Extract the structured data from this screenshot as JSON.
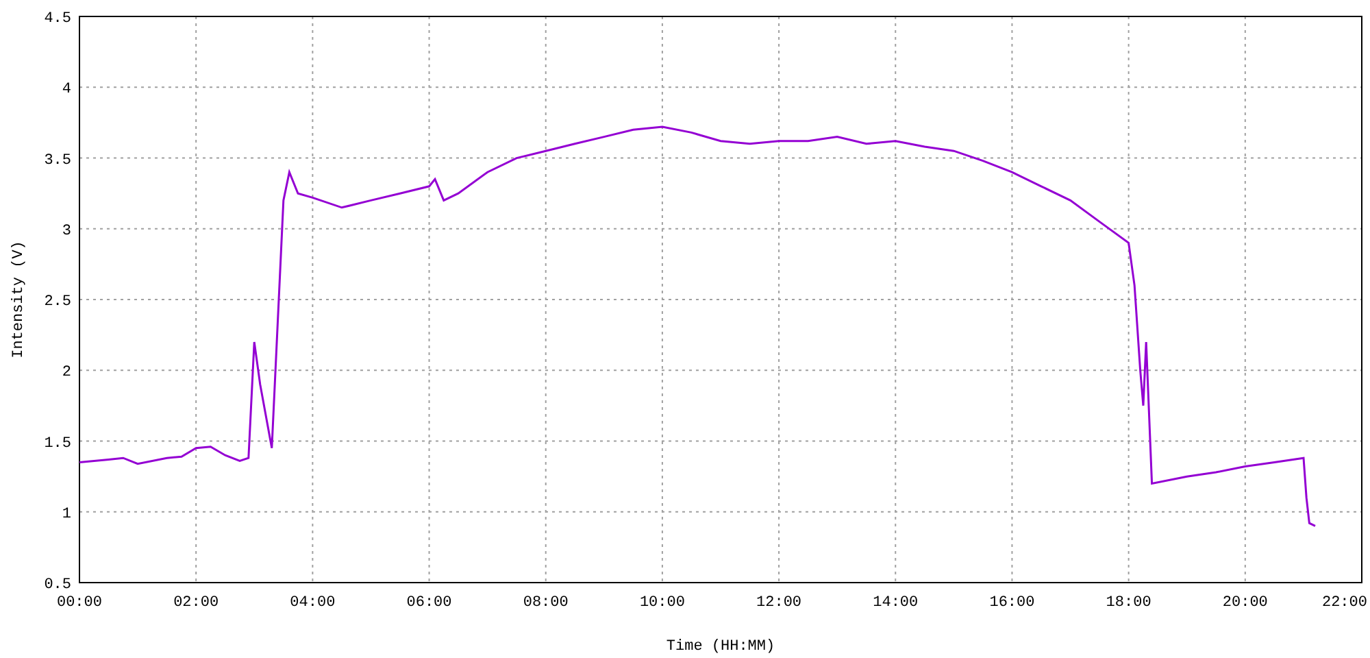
{
  "chart": {
    "chart_data": {
      "type": "line",
      "grid": true,
      "xlabel": "Time (HH:MM)",
      "ylabel": "Intensity (V)",
      "x": [
        0,
        0.5,
        0.75,
        1.0,
        1.5,
        1.75,
        2.0,
        2.25,
        2.5,
        2.75,
        2.9,
        3.0,
        3.1,
        3.3,
        3.5,
        3.6,
        3.75,
        4.0,
        4.5,
        5,
        5.5,
        6,
        6.1,
        6.25,
        6.5,
        7,
        7.5,
        8,
        8.5,
        9,
        9.5,
        10,
        10.5,
        11,
        11.5,
        12,
        12.5,
        13,
        13.5,
        14,
        14.5,
        15,
        15.5,
        16,
        16.5,
        17,
        17.5,
        18,
        18.1,
        18.2,
        18.25,
        18.3,
        18.4,
        19,
        19.5,
        20,
        20.5,
        21,
        21.05,
        21.1,
        21.2
      ],
      "series": [
        {
          "color": "#9400d3",
          "values": [
            1.35,
            1.37,
            1.38,
            1.34,
            1.38,
            1.39,
            1.45,
            1.46,
            1.4,
            1.36,
            1.38,
            2.2,
            1.9,
            1.45,
            3.2,
            3.4,
            3.25,
            3.22,
            3.15,
            3.2,
            3.25,
            3.3,
            3.35,
            3.2,
            3.25,
            3.4,
            3.5,
            3.55,
            3.6,
            3.65,
            3.7,
            3.72,
            3.68,
            3.62,
            3.6,
            3.62,
            3.62,
            3.65,
            3.6,
            3.62,
            3.58,
            3.55,
            3.48,
            3.4,
            3.3,
            3.2,
            3.05,
            2.9,
            2.6,
            2.0,
            1.75,
            2.2,
            1.2,
            1.25,
            1.28,
            1.32,
            1.35,
            1.38,
            1.1,
            0.92,
            0.9
          ]
        }
      ],
      "xlim": [
        0,
        22
      ],
      "ylim": [
        0.5,
        4.5
      ],
      "xticks": [
        {
          "value": 0,
          "label": "00:00"
        },
        {
          "value": 2,
          "label": "02:00"
        },
        {
          "value": 4,
          "label": "04:00"
        },
        {
          "value": 6,
          "label": "06:00"
        },
        {
          "value": 8,
          "label": "08:00"
        },
        {
          "value": 10,
          "label": "10:00"
        },
        {
          "value": 12,
          "label": "12:00"
        },
        {
          "value": 14,
          "label": "14:00"
        },
        {
          "value": 16,
          "label": "16:00"
        },
        {
          "value": 18,
          "label": "18:00"
        },
        {
          "value": 20,
          "label": "20:00"
        },
        {
          "value": 22,
          "label": "22:00"
        }
      ],
      "yticks": [
        {
          "value": 0.5,
          "label": "0.5"
        },
        {
          "value": 1,
          "label": "1"
        },
        {
          "value": 1.5,
          "label": "1.5"
        },
        {
          "value": 2,
          "label": "2"
        },
        {
          "value": 2.5,
          "label": "2.5"
        },
        {
          "value": 3,
          "label": "3"
        },
        {
          "value": 3.5,
          "label": "3.5"
        },
        {
          "value": 4,
          "label": "4"
        },
        {
          "value": 4.5,
          "label": "4.5"
        }
      ]
    }
  }
}
